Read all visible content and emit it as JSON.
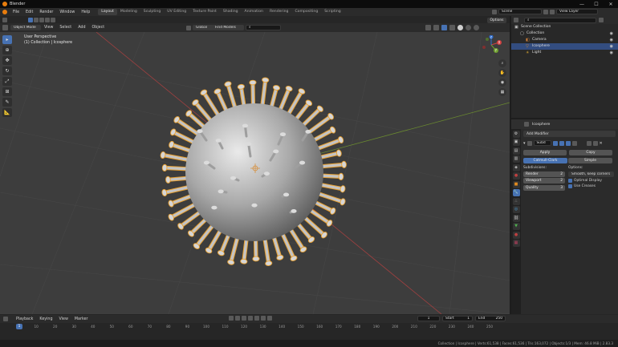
{
  "window": {
    "title": "Blender",
    "min": "—",
    "max": "☐",
    "close": "✕"
  },
  "menus": [
    "File",
    "Edit",
    "Render",
    "Window",
    "Help"
  ],
  "workspaces": [
    "Layout",
    "Modeling",
    "Sculpting",
    "UV Editing",
    "Texture Paint",
    "Shading",
    "Animation",
    "Rendering",
    "Compositing",
    "Scripting"
  ],
  "active_workspace": "Layout",
  "scene": {
    "name": "Scene",
    "view_layer": "View Layer"
  },
  "viewport_header": {
    "mode": "Object Mode",
    "menus": [
      "View",
      "Select",
      "Add",
      "Object"
    ],
    "orientation": "Global",
    "find_models": "Find Models",
    "options": "Options"
  },
  "viewport_overlay": {
    "view": "User Perspective",
    "collection": "(1) Collection | Icosphere"
  },
  "toolbar_icons": [
    "select-box-icon",
    "cursor-icon",
    "move-icon",
    "rotate-icon",
    "scale-icon",
    "transform-icon",
    "annotate-icon",
    "measure-icon"
  ],
  "gizmo": {
    "x": "X",
    "y": "Y",
    "z": "Z"
  },
  "outliner": {
    "rows": [
      {
        "label": "Scene Collection",
        "indent": 0,
        "selected": false,
        "icon": "scene-collection-icon"
      },
      {
        "label": "Collection",
        "indent": 1,
        "selected": false,
        "icon": "collection-icon"
      },
      {
        "label": "Camera",
        "indent": 2,
        "selected": false,
        "icon": "camera-icon"
      },
      {
        "label": "Icosphere",
        "indent": 2,
        "selected": true,
        "icon": "mesh-icon"
      },
      {
        "label": "Light",
        "indent": 2,
        "selected": false,
        "icon": "light-icon"
      }
    ]
  },
  "properties": {
    "object_name": "Icosphere",
    "add_modifier": "Add Modifier",
    "modifier_name": "Subd",
    "apply": "Apply",
    "copy": "Copy",
    "mode_a": "Catmull-Clark",
    "mode_b": "Simple",
    "subdivisions_label": "Subdivisions:",
    "render_label": "Render",
    "render_val": "2",
    "viewport_label": "Viewport",
    "viewport_val": "2",
    "quality_label": "Quality",
    "quality_val": "3",
    "options_label": "Options:",
    "uv_smooth": "Smooth, keep corners",
    "optimal_display": "Optimal Display",
    "use_creases": "Use Creases"
  },
  "timeline": {
    "menus": [
      "Playback",
      "Keying",
      "View",
      "Marker"
    ],
    "current_frame": "1",
    "start_label": "Start",
    "start": "1",
    "end_label": "End",
    "end": "250",
    "ticks": [
      "1",
      "10",
      "20",
      "30",
      "40",
      "50",
      "60",
      "70",
      "80",
      "90",
      "100",
      "110",
      "120",
      "130",
      "140",
      "150",
      "160",
      "170",
      "180",
      "190",
      "200",
      "210",
      "220",
      "230",
      "240",
      "250"
    ]
  },
  "status": "Collection | Icosphere | Verts:61,538 | Faces:61,536 | Tris:163,072 | Objects:1/3 | Mem: 46.8 MiB | 2.83.3",
  "colors": {
    "accent": "#4772b3",
    "selection_outline": "#e8a030",
    "brand": "#e87d0d"
  }
}
